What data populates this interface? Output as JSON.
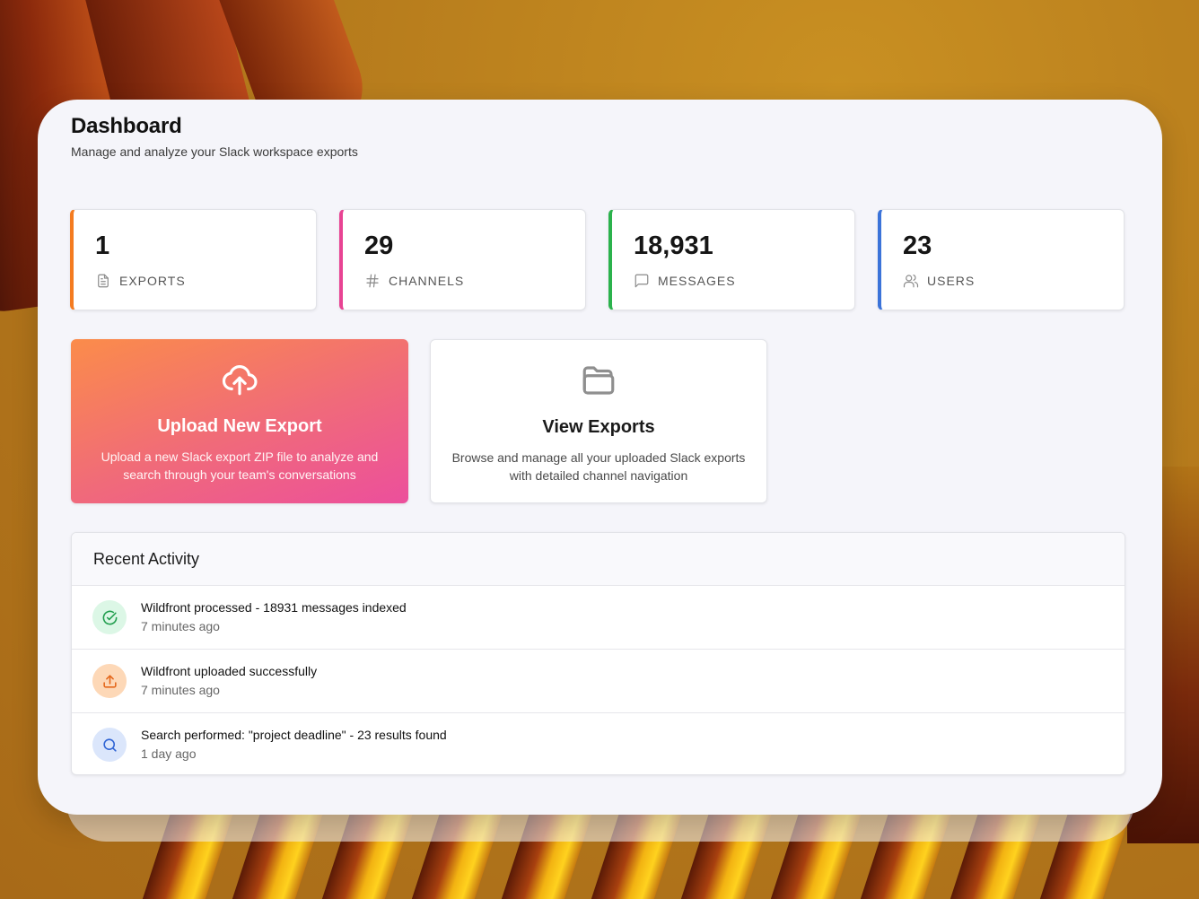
{
  "header": {
    "title": "Dashboard",
    "subtitle": "Manage and analyze your Slack workspace exports"
  },
  "stats": [
    {
      "value": "1",
      "label": "EXPORTS",
      "icon": "document-icon",
      "accent": "#f47b20"
    },
    {
      "value": "29",
      "label": "CHANNELS",
      "icon": "hash-icon",
      "accent": "#e84393"
    },
    {
      "value": "18,931",
      "label": "MESSAGES",
      "icon": "chat-bubble-icon",
      "accent": "#2bb24c"
    },
    {
      "value": "23",
      "label": "USERS",
      "icon": "users-icon",
      "accent": "#3b73d9"
    }
  ],
  "actions": {
    "upload": {
      "title": "Upload New Export",
      "description": "Upload a new Slack export ZIP file to analyze and search through your team's conversations",
      "icon": "cloud-upload-icon"
    },
    "view": {
      "title": "View Exports",
      "description": "Browse and manage all your uploaded Slack exports with detailed channel navigation",
      "icon": "folder-icon"
    }
  },
  "activity": {
    "title": "Recent Activity",
    "items": [
      {
        "text": "Wildfront processed - 18931 messages indexed",
        "time": "7 minutes ago",
        "icon": "check-circle-icon",
        "color": "#1f9d4c"
      },
      {
        "text": "Wildfront uploaded successfully",
        "time": "7 minutes ago",
        "icon": "upload-icon",
        "color": "#e4671b"
      },
      {
        "text": "Search performed: \"project deadline\" - 23 results found",
        "time": "1 day ago",
        "icon": "search-icon",
        "color": "#2f64d4"
      }
    ]
  }
}
